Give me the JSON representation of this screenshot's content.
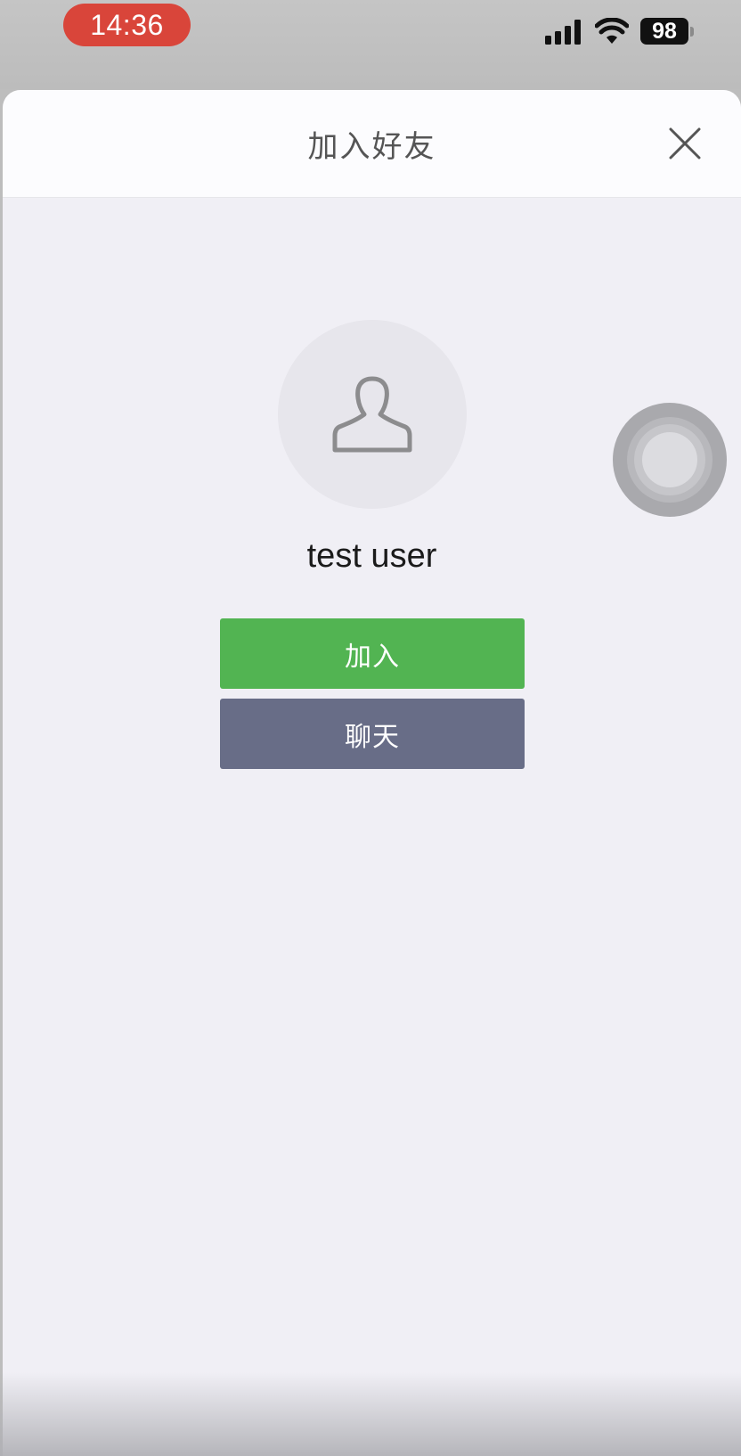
{
  "status_bar": {
    "time": "14:36",
    "battery_level": "98",
    "icons": [
      "signal-icon",
      "wifi-icon",
      "battery-icon"
    ],
    "time_pill_color": "#d9453a"
  },
  "sheet": {
    "title": "加入好友",
    "close_icon": "close-icon"
  },
  "profile": {
    "avatar_icon": "user-placeholder-icon",
    "name": "test user"
  },
  "actions": {
    "join_label": "加入",
    "chat_label": "聊天",
    "join_color": "#52b452",
    "chat_color": "#686d87"
  },
  "overlay": {
    "assistive_touch_icon": "assistive-touch-icon"
  }
}
